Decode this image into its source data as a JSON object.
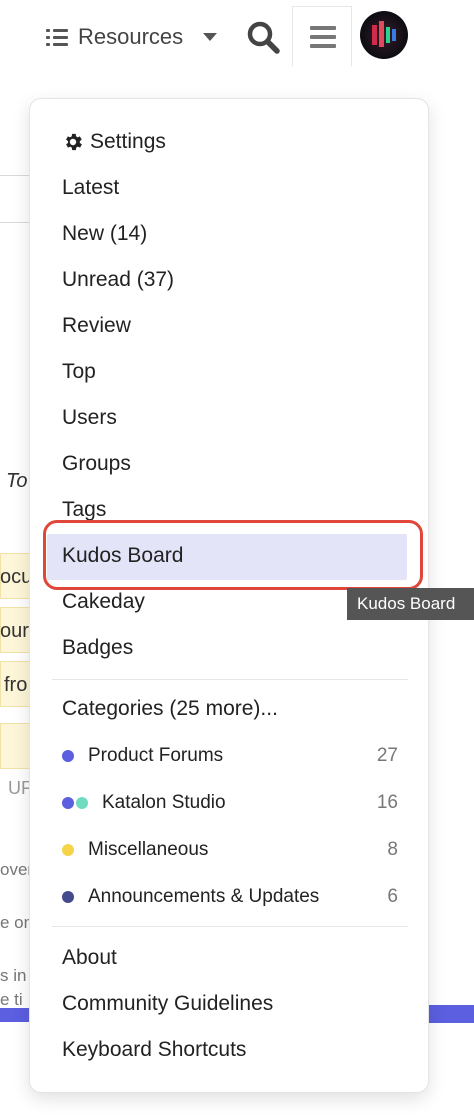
{
  "header": {
    "resources_label": "Resources",
    "icons": [
      "list-icon",
      "chevron-down-icon",
      "search-icon",
      "hamburger-menu-icon",
      "avatar"
    ]
  },
  "background_fragments": [
    "To",
    "ocu",
    "our",
    "fro",
    "UF",
    "over",
    "e on",
    "s in",
    "e ti"
  ],
  "menu": {
    "settings_label": "Settings",
    "links": [
      "Latest",
      "New (14)",
      "Unread (37)",
      "Review",
      "Top",
      "Users",
      "Groups",
      "Tags",
      "Kudos Board",
      "Cakeday",
      "Badges"
    ],
    "highlighted_item": "Kudos Board",
    "categories_label": "Categories (25 more)...",
    "categories": [
      {
        "name": "Product Forums",
        "count": "27",
        "colors": [
          "#5b5fe0"
        ]
      },
      {
        "name": "Katalon Studio",
        "count": "16",
        "colors": [
          "#5b5fe0",
          "#6fdcc0"
        ]
      },
      {
        "name": "Miscellaneous",
        "count": "8",
        "colors": [
          "#f5d44a"
        ]
      },
      {
        "name": "Announcements & Updates",
        "count": "6",
        "colors": [
          "#444b8c"
        ]
      }
    ],
    "footer_links": [
      "About",
      "Community Guidelines",
      "Keyboard Shortcuts"
    ]
  },
  "tooltip": "Kudos Board",
  "colors": {
    "accent": "#5b5fe0",
    "highlight_bg": "#e3e4f8",
    "annotation_ring": "#e0473a",
    "tooltip_bg": "#555555"
  }
}
